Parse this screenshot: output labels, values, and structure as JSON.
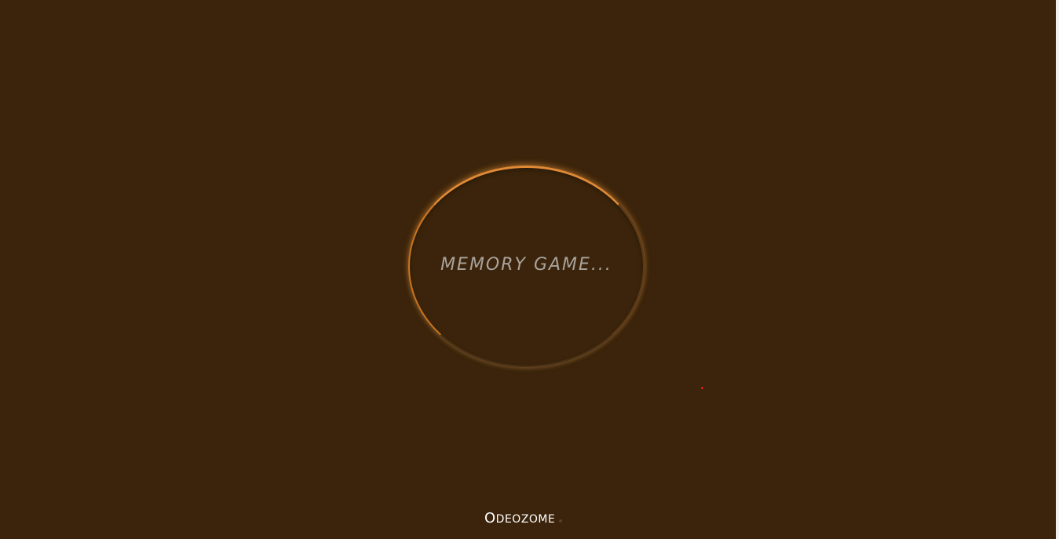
{
  "loader": {
    "text": "MEMORY GAME..."
  },
  "footer": {
    "brand_initial": "O",
    "brand_rest": "DEOZOME"
  },
  "colors": {
    "background": "#3b240b",
    "ring_accent": "#e08a35",
    "text": "#a8a29a",
    "dot": "#e31b1b"
  }
}
